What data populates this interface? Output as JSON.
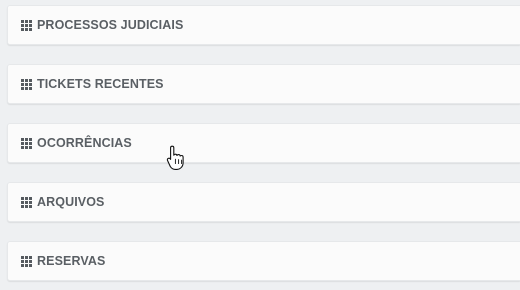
{
  "panels": [
    {
      "title": "PROCESSOS JUDICIAIS",
      "icon": "grid-icon"
    },
    {
      "title": "TICKETS RECENTES",
      "icon": "grid-icon"
    },
    {
      "title": "OCORRÊNCIAS",
      "icon": "grid-icon"
    },
    {
      "title": "ARQUIVOS",
      "icon": "grid-icon"
    },
    {
      "title": "RESERVAS",
      "icon": "grid-icon"
    }
  ],
  "cursor": {
    "icon": "hand-pointer-icon"
  }
}
